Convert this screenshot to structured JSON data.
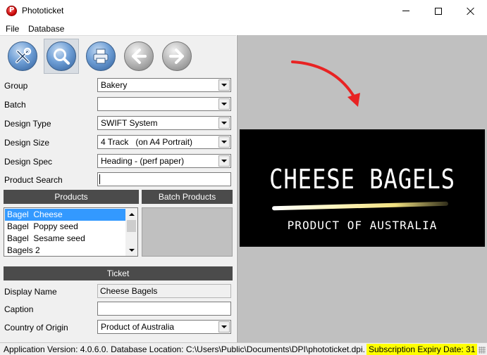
{
  "window": {
    "title": "Phototicket",
    "controls": [
      "minimize-icon",
      "maximize-icon",
      "close-icon"
    ]
  },
  "menu": {
    "items": [
      "File",
      "Database"
    ]
  },
  "toolbar": {
    "buttons": [
      {
        "icon": "tools-icon",
        "active": false
      },
      {
        "icon": "search-icon",
        "active": true
      },
      {
        "icon": "printer-icon",
        "active": false
      },
      {
        "icon": "arrow-left-icon",
        "active": false
      },
      {
        "icon": "arrow-right-icon",
        "active": false
      }
    ]
  },
  "form": {
    "group": {
      "label": "Group",
      "value": "Bakery"
    },
    "batch": {
      "label": "Batch",
      "value": ""
    },
    "design_type": {
      "label": "Design Type",
      "value": "SWIFT System"
    },
    "design_size": {
      "label": "Design Size",
      "value": "4 Track   (on A4 Portrait)"
    },
    "design_spec": {
      "label": "Design Spec",
      "value": "Heading - (perf paper)"
    },
    "product_search": {
      "label": "Product Search",
      "value": ""
    }
  },
  "products": {
    "header": "Products",
    "items": [
      {
        "label": "Bagel  Cheese",
        "selected": true
      },
      {
        "label": "Bagel  Poppy seed",
        "selected": false
      },
      {
        "label": "Bagel  Sesame seed",
        "selected": false
      },
      {
        "label": "Bagels 2",
        "selected": false
      }
    ]
  },
  "batch_products": {
    "header": "Batch Products"
  },
  "ticket": {
    "header": "Ticket",
    "display_name": {
      "label": "Display Name",
      "value": "Cheese Bagels"
    },
    "caption": {
      "label": "Caption",
      "value": ""
    },
    "country_of_origin": {
      "label": "Country of Origin",
      "value": "Product of Australia"
    }
  },
  "preview": {
    "title": "CHEESE BAGELS",
    "subtitle": "PRODUCT OF AUSTRALIA",
    "background": "#000000",
    "annotation_color": "#e82323"
  },
  "status": {
    "info": "Application Version: 4.0.6.0.  Database Location: C:\\Users\\Public\\Documents\\DPI\\phototicket.dpi.",
    "expiry": "Subscription Expiry Date: 31",
    "expiry_highlight": "#ffff00"
  },
  "colors": {
    "selection": "#3399ff",
    "section_header": "#4b4b4b",
    "preview_panel": "#c0c0c0"
  }
}
